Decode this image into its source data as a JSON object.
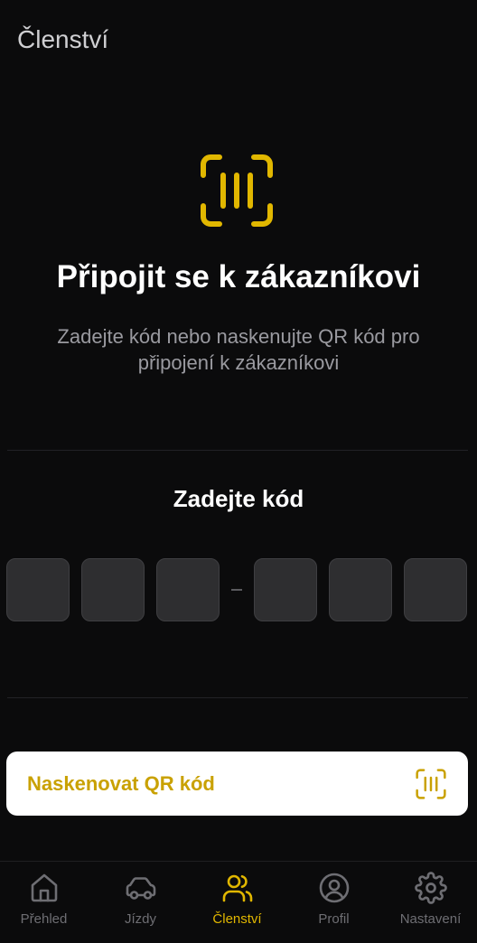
{
  "header": {
    "title": "Členství"
  },
  "hero": {
    "icon": "qr-scan-icon",
    "title": "Připojit se k zákazníkovi",
    "subtitle": "Zadejte kód nebo naskenujte QR kód pro připojení k zákazníkovi"
  },
  "code_entry": {
    "label": "Zadejte kód",
    "digits": [
      "",
      "",
      "",
      "",
      "",
      ""
    ],
    "separator_icon": "dash-separator"
  },
  "scan_button": {
    "label": "Naskenovat QR kód",
    "icon": "qr-scan-icon"
  },
  "tabbar": {
    "items": [
      {
        "label": "Přehled",
        "icon": "home-icon",
        "active": false
      },
      {
        "label": "Jízdy",
        "icon": "car-icon",
        "active": false
      },
      {
        "label": "Členství",
        "icon": "users-icon",
        "active": true
      },
      {
        "label": "Profil",
        "icon": "user-circle-icon",
        "active": false
      },
      {
        "label": "Nastavení",
        "icon": "gear-icon",
        "active": false
      }
    ]
  },
  "colors": {
    "background": "#0b0b0c",
    "accent": "#e1b700",
    "accent_on_white": "#c9a100",
    "tab_inactive": "#6e6e73",
    "code_box": "#2e2e30"
  }
}
